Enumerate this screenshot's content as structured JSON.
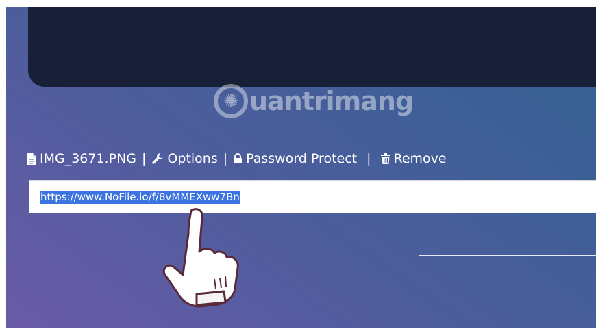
{
  "watermark": {
    "brand": "uantrimang"
  },
  "toolbar": {
    "filename": "IMG_3671.PNG",
    "sep1": "|",
    "options_label": "Options",
    "sep2": "|",
    "password_label": "Password Protect",
    "sep3": "|",
    "remove_label": "Remove"
  },
  "share": {
    "url": "https://www.NoFile.io/f/8vMMEXww7Bn"
  },
  "icons": {
    "file": "file-icon",
    "options": "wrench-icon",
    "password": "lock-icon",
    "remove": "trash-icon",
    "pointer": "pointing-hand-icon"
  },
  "colors": {
    "background_start": "#6a5aa8",
    "background_end": "#35618f",
    "dark_panel": "#172036",
    "selection": "#3b73e0",
    "text": "#ffffff"
  }
}
